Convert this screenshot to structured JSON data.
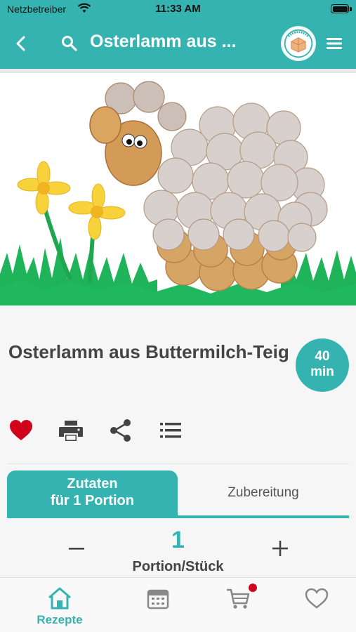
{
  "status_bar": {
    "carrier": "Netzbetreiber",
    "time": "11:33 AM"
  },
  "nav": {
    "title": "Osterlamm aus ...",
    "icons": {
      "back": "chevron-left-icon",
      "search": "search-icon",
      "logo": "brand-logo",
      "menu": "hamburger-menu-icon"
    }
  },
  "recipe": {
    "title": "Osterlamm aus Buttermilch-Teig",
    "time_value": "40",
    "time_unit": "min",
    "hero_image": "easter-lamb-bread-photo"
  },
  "actions": [
    {
      "name": "favorite",
      "icon": "heart-icon",
      "color": "#d0021b"
    },
    {
      "name": "print",
      "icon": "printer-icon"
    },
    {
      "name": "share",
      "icon": "share-icon"
    },
    {
      "name": "shopping-list",
      "icon": "list-icon"
    }
  ],
  "tabs": {
    "active_line1": "Zutaten",
    "active_line2": "für 1 Portion",
    "inactive": "Zubereitung"
  },
  "portion": {
    "value": "1",
    "label": "Portion/Stück"
  },
  "tabbar": {
    "items": [
      {
        "label": "Rezepte",
        "icon": "home-icon",
        "active": true
      },
      {
        "label": "",
        "icon": "calendar-icon",
        "active": false
      },
      {
        "label": "",
        "icon": "cart-icon",
        "active": false,
        "badge": true
      },
      {
        "label": "",
        "icon": "heart-outline-icon",
        "active": false
      }
    ]
  },
  "colors": {
    "accent": "#35b3b0",
    "favorite": "#d0021b",
    "badge": "#d0021b"
  }
}
